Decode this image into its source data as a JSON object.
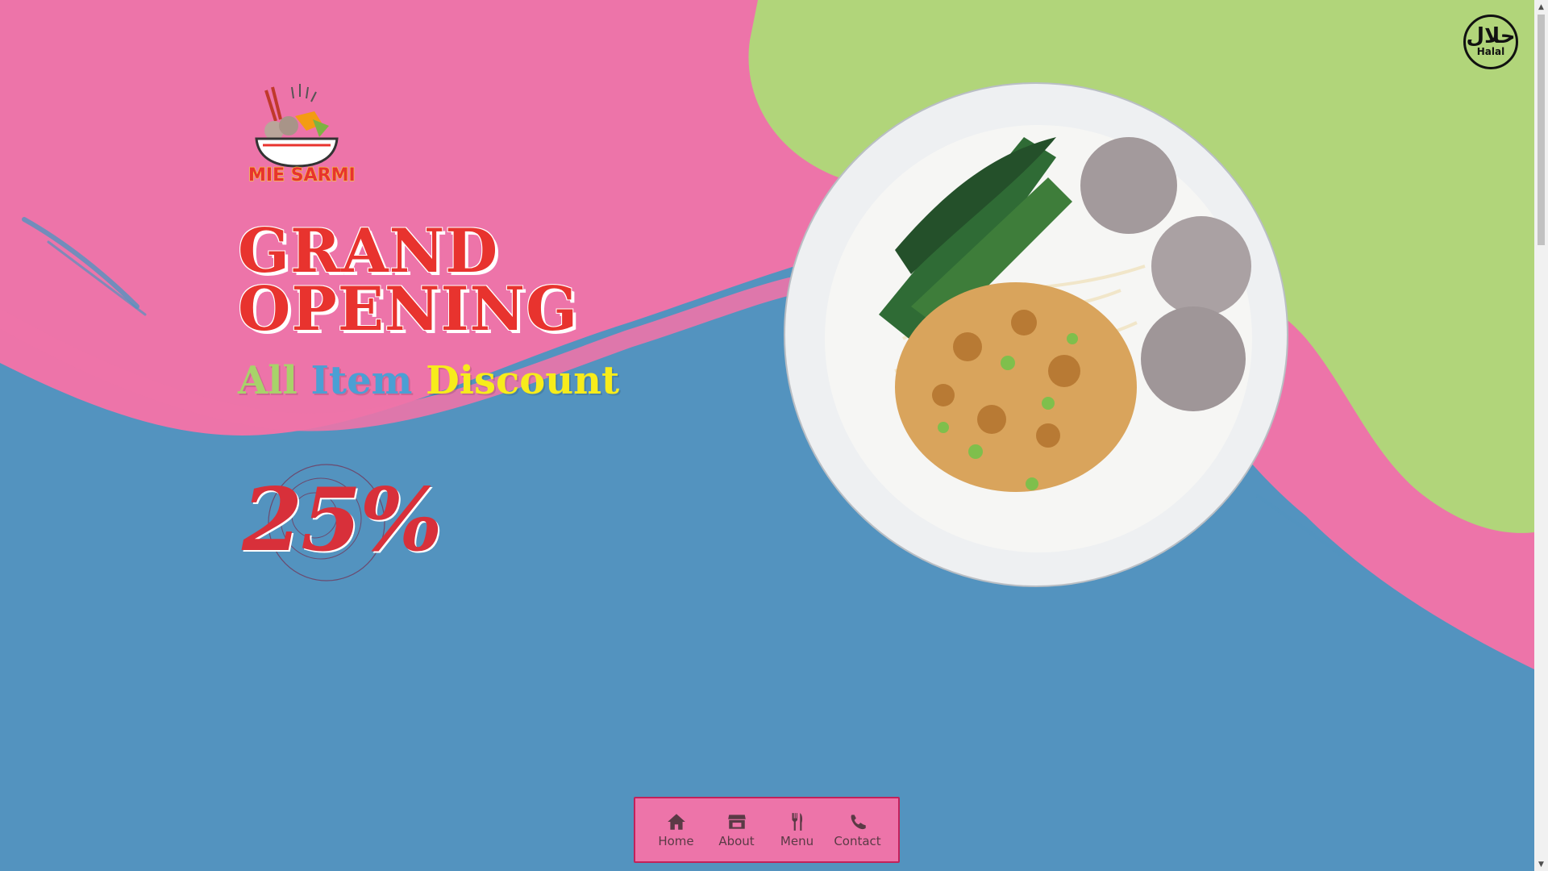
{
  "colors": {
    "pink": "#ed74a9",
    "green": "#b1d57a",
    "blue": "#5393bf",
    "red": "#e8332e",
    "yellow": "#f7ec1b"
  },
  "logo": {
    "text": "MIE SARMI",
    "icon": "noodle-bowl-logo-icon"
  },
  "hero": {
    "headline_line1": "GRAND",
    "headline_line2": "OPENING",
    "tagline_all": "All",
    "tagline_item": "Item",
    "tagline_discount": "Discount",
    "discount": "25%"
  },
  "badge": {
    "arabic": "حلال",
    "label": "Halal"
  },
  "nav": {
    "items": [
      {
        "label": "Home",
        "icon": "home-icon"
      },
      {
        "label": "About",
        "icon": "store-icon"
      },
      {
        "label": "Menu",
        "icon": "utensils-icon"
      },
      {
        "label": "Contact",
        "icon": "phone-icon"
      }
    ]
  },
  "food_image": {
    "icon": "meatball-noodle-bowl-image"
  }
}
